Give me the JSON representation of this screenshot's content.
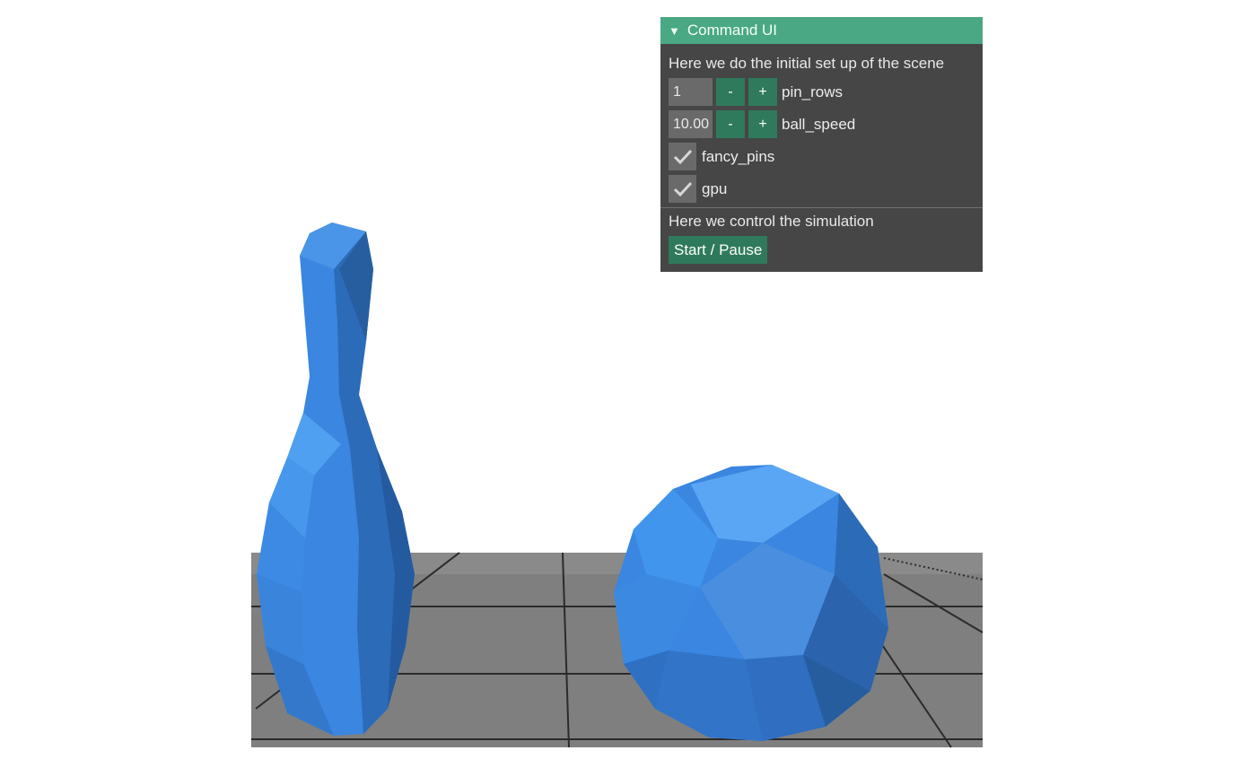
{
  "panel": {
    "title": "Command UI",
    "setup_text": "Here we do the initial set up of the scene",
    "controls": [
      {
        "value": "1",
        "minus": "-",
        "plus": "+",
        "label": "pin_rows"
      },
      {
        "value": "10.00",
        "minus": "-",
        "plus": "+",
        "label": "ball_speed"
      }
    ],
    "checkboxes": [
      {
        "label": "fancy_pins",
        "checked": true
      },
      {
        "label": "gpu",
        "checked": true
      }
    ],
    "sim_text": "Here we control the simulation",
    "start_label": "Start / Pause"
  },
  "colors": {
    "panel_bg": "#464646",
    "header_bg": "#4aa884",
    "button_bg": "#2f7a5c",
    "object_blue": "#3a86e0",
    "floor_gray": "#7e7e7e"
  }
}
